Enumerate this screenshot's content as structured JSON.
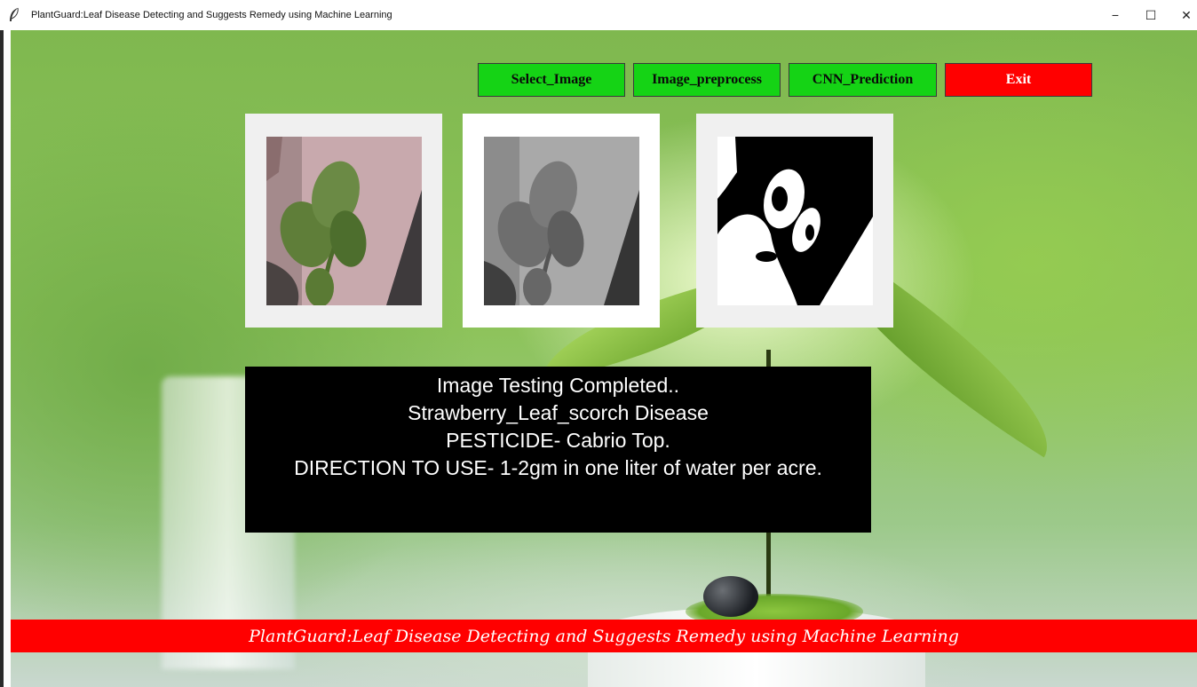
{
  "window": {
    "title": "PlantGuard:Leaf Disease Detecting and Suggests Remedy using Machine Learning",
    "icon": "feather-icon",
    "controls": {
      "minimize": "−",
      "maximize": "☐",
      "close": "✕"
    }
  },
  "toolbar": {
    "select_image": "Select_Image",
    "image_preprocess": "Image_preprocess",
    "cnn_prediction": "CNN_Prediction",
    "exit": "Exit"
  },
  "images": {
    "original": "color-leaf-image",
    "grayscale": "grayscale-leaf-image",
    "binary": "binary-threshold-leaf-image"
  },
  "result": {
    "line1": "Image Testing Completed..",
    "line2": "Strawberry_Leaf_scorch Disease",
    "line3": "PESTICIDE- Cabrio Top.",
    "line4": "DIRECTION TO USE- 1-2gm in one liter of water per acre."
  },
  "footer": {
    "banner": "PlantGuard:Leaf Disease Detecting and Suggests Remedy using Machine Learning"
  },
  "colors": {
    "button_green": "#15d315",
    "button_red": "#ff0000",
    "result_bg": "#000000",
    "footer_bg": "#ff0000"
  }
}
